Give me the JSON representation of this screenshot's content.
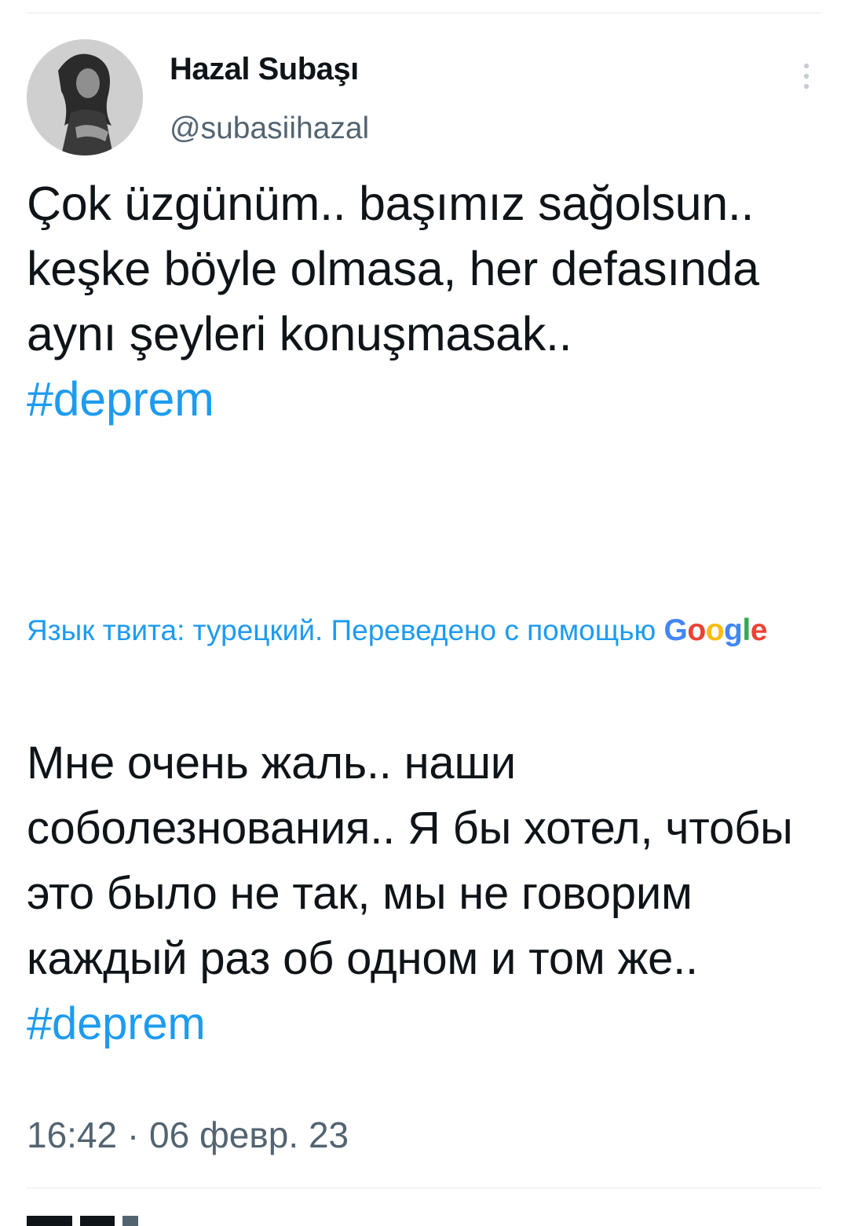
{
  "author": {
    "name": "Hazal Subaşı",
    "handle": "@subasiihazal",
    "avatar_icon": "profile-photo"
  },
  "tweet": {
    "text": "Çok üzgünüm.. başımız sağolsun.. keşke böyle olmasa, her defasında aynı şeyleri konuşmasak..",
    "hashtag": "#deprem"
  },
  "translation": {
    "note": "Язык твита: турецкий. Переведено с помощью",
    "provider": {
      "letters": [
        "G",
        "o",
        "o",
        "g",
        "l",
        "e"
      ],
      "colors": [
        "#4285f4",
        "#ea4335",
        "#fbbc05",
        "#4285f4",
        "#34a853",
        "#ea4335"
      ]
    },
    "text": "Мне очень жаль.. наши соболезнования.. Я бы хотел, чтобы это было не так, мы не говорим каждый раз об одном и том же..",
    "hashtag": "#deprem"
  },
  "timestamp": "16:42 · 06 февр. 23",
  "colors": {
    "accent": "#1d9bf0",
    "text": "#0f1419",
    "secondary": "#536471",
    "divider": "#e7e9ea"
  }
}
